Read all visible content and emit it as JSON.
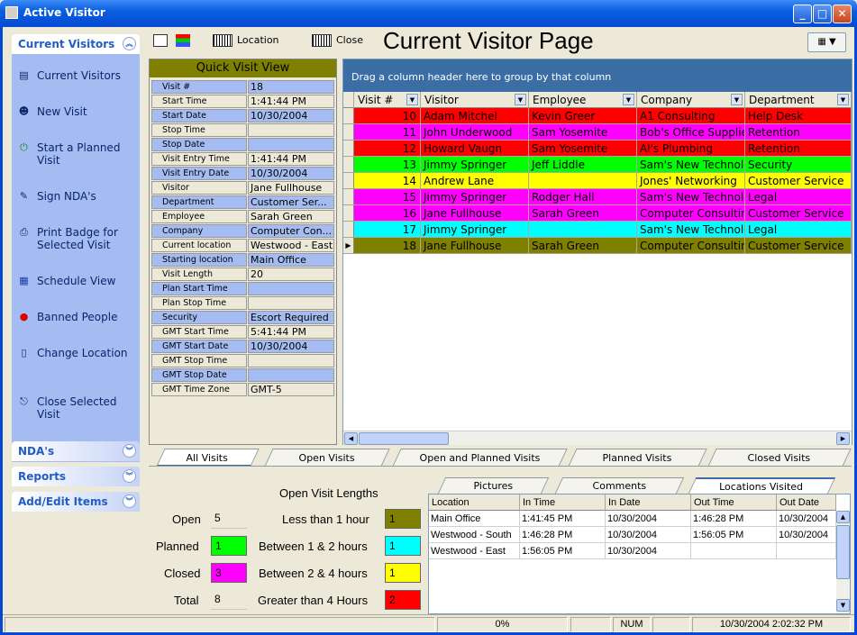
{
  "window": {
    "title": "Active Visitor"
  },
  "nav": {
    "current_visitors_header": "Current Visitors",
    "items": [
      {
        "label": "Current Visitors",
        "icon": "table-icon"
      },
      {
        "label": "New Visit",
        "icon": "person-icon"
      },
      {
        "label": "Start a Planned Visit",
        "icon": "power-icon"
      },
      {
        "label": "Sign NDA's",
        "icon": "pen-icon"
      },
      {
        "label": "Print Badge for Selected Visit",
        "icon": "printer-icon"
      },
      {
        "label": "Schedule View",
        "icon": "calendar-icon"
      },
      {
        "label": "Banned People",
        "icon": "stop-icon"
      },
      {
        "label": "Change Location",
        "icon": "door-icon"
      },
      {
        "label": "Close Selected Visit",
        "icon": "exit-icon"
      }
    ],
    "ndas_header": "NDA's",
    "reports_header": "Reports",
    "add_edit_header": "Add/Edit Items"
  },
  "toolbar": {
    "location_label": "Location",
    "close_label": "Close"
  },
  "page_title": "Current Visitor Page",
  "quick_view": {
    "title": "Quick Visit View",
    "rows": [
      {
        "key": "Visit #",
        "value": "18"
      },
      {
        "key": "Start Time",
        "value": "1:41:44 PM"
      },
      {
        "key": "Start Date",
        "value": "10/30/2004"
      },
      {
        "key": "Stop Time",
        "value": ""
      },
      {
        "key": "Stop Date",
        "value": ""
      },
      {
        "key": "Visit Entry Time",
        "value": "1:41:44 PM"
      },
      {
        "key": "Visit Entry Date",
        "value": "10/30/2004"
      },
      {
        "key": "Visitor",
        "value": "Jane Fullhouse"
      },
      {
        "key": "Department",
        "value": "Customer Ser..."
      },
      {
        "key": "Employee",
        "value": "Sarah Green"
      },
      {
        "key": "Company",
        "value": "Computer Con..."
      },
      {
        "key": "Current location",
        "value": "Westwood - East"
      },
      {
        "key": "Starting location",
        "value": "Main Office"
      },
      {
        "key": "Visit Length",
        "value": "20"
      },
      {
        "key": "Plan Start Time",
        "value": ""
      },
      {
        "key": "Plan Stop Time",
        "value": ""
      },
      {
        "key": "Security",
        "value": "Escort Required"
      },
      {
        "key": "GMT Start Time",
        "value": "5:41:44 PM"
      },
      {
        "key": "GMT Start Date",
        "value": "10/30/2004"
      },
      {
        "key": "GMT Stop Time",
        "value": ""
      },
      {
        "key": "GMT Stop Date",
        "value": ""
      },
      {
        "key": "GMT Time Zone",
        "value": "GMT-5"
      }
    ]
  },
  "grid": {
    "group_hint": "Drag a column header here to group by that column",
    "columns": [
      "Visit #",
      "Visitor",
      "Employee",
      "Company",
      "Department"
    ],
    "rows": [
      {
        "visit": "10",
        "visitor": "Adam Mitchel",
        "employee": "Kevin Greer",
        "company": "A1 Consulting",
        "department": "Help Desk",
        "color": "#ff0000"
      },
      {
        "visit": "11",
        "visitor": "John Underwood",
        "employee": "Sam Yosemite",
        "company": "Bob's Office Supplie",
        "department": "Retention",
        "color": "#ff00ff"
      },
      {
        "visit": "12",
        "visitor": "Howard Vaugn",
        "employee": "Sam Yosemite",
        "company": "Al's Plumbing",
        "department": "Retention",
        "color": "#ff0000"
      },
      {
        "visit": "13",
        "visitor": "Jimmy Springer",
        "employee": "Jeff Liddle",
        "company": "Sam's New Technolo",
        "department": "Security",
        "color": "#00ff00"
      },
      {
        "visit": "14",
        "visitor": "Andrew Lane",
        "employee": "",
        "company": "Jones' Networking",
        "department": "Customer Service",
        "color": "#ffff00"
      },
      {
        "visit": "15",
        "visitor": "Jimmy Springer",
        "employee": "Rodger Hall",
        "company": "Sam's New Technolo",
        "department": "Legal",
        "color": "#ff00ff"
      },
      {
        "visit": "16",
        "visitor": "Jane Fullhouse",
        "employee": "Sarah Green",
        "company": "Computer Consultin",
        "department": "Customer Service",
        "color": "#ff00ff"
      },
      {
        "visit": "17",
        "visitor": "Jimmy Springer",
        "employee": "",
        "company": "Sam's New Technolo",
        "department": "Legal",
        "color": "#00ffff"
      },
      {
        "visit": "18",
        "visitor": "Jane Fullhouse",
        "employee": "Sarah Green",
        "company": "Computer Consultin",
        "department": "Customer Service",
        "color": "#808000"
      }
    ]
  },
  "tabs": [
    "All Visits",
    "Open Visits",
    "Open and Planned Visits",
    "Planned Visits",
    "Closed Visits"
  ],
  "stats": {
    "open_label": "Open",
    "open_value": "5",
    "planned_label": "Planned",
    "planned_value": "1",
    "closed_label": "Closed",
    "closed_value": "3",
    "total_label": "Total",
    "total_value": "8",
    "lengths_title": "Open Visit Lengths",
    "lengths": [
      {
        "label": "Less than 1 hour",
        "value": "1",
        "color": "#808000"
      },
      {
        "label": "Between 1 & 2 hours",
        "value": "1",
        "color": "#00ffff"
      },
      {
        "label": "Between 2 & 4 hours",
        "value": "1",
        "color": "#ffff00"
      },
      {
        "label": "Greater than 4 Hours",
        "value": "2",
        "color": "#ff0000"
      }
    ],
    "planned_color": "#00ff00",
    "closed_color": "#ff00ff"
  },
  "detail_tabs": [
    "Pictures",
    "Comments",
    "Locations Visited"
  ],
  "locations": {
    "columns": [
      "Location",
      "In Time",
      "In Date",
      "Out Time",
      "Out Date"
    ],
    "rows": [
      [
        "Main Office",
        "1:41:45 PM",
        "10/30/2004",
        "1:46:28 PM",
        "10/30/2004"
      ],
      [
        "Westwood - South",
        "1:46:28 PM",
        "10/30/2004",
        "1:56:05 PM",
        "10/30/2004"
      ],
      [
        "Westwood - East",
        "1:56:05 PM",
        "10/30/2004",
        "",
        ""
      ]
    ]
  },
  "status": {
    "progress": "0%",
    "num": "NUM",
    "datetime": "10/30/2004 2:02:32 PM"
  }
}
